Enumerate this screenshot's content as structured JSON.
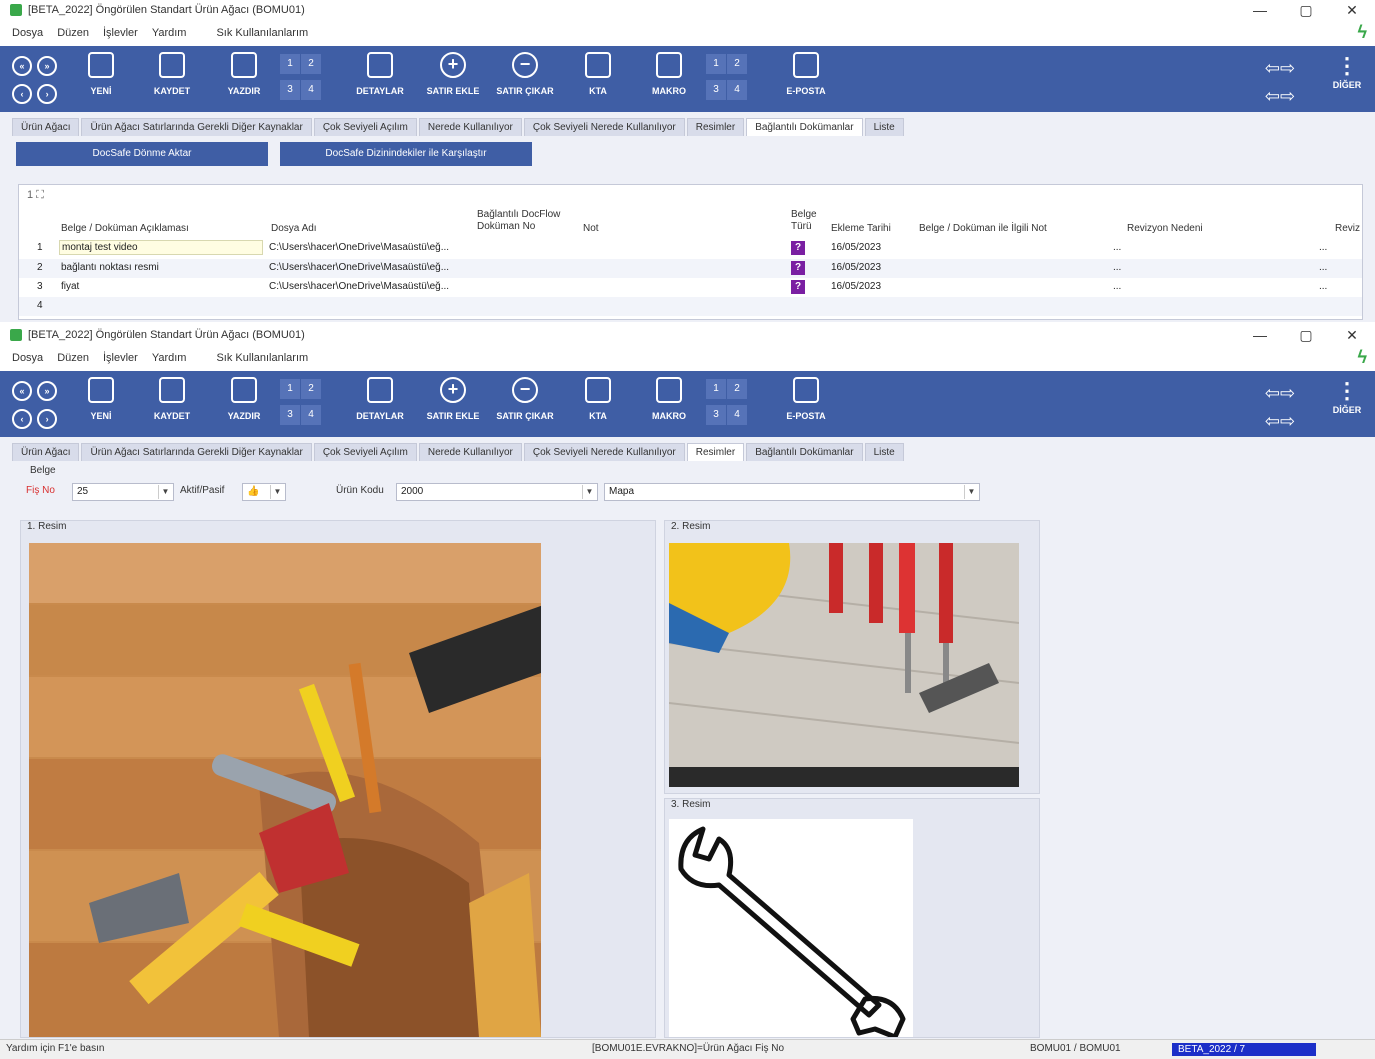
{
  "window": {
    "title": "[BETA_2022] Öngörülen Standart Ürün Ağacı (BOMU01)",
    "controls": [
      "—",
      "▢",
      "✕"
    ]
  },
  "menu": [
    "Dosya",
    "Düzen",
    "İşlevler",
    "Yardım",
    "Sık Kullanılanlarım"
  ],
  "toolbar": {
    "nav_top": [
      "«",
      "»"
    ],
    "nav_bottom": [
      "‹",
      "›"
    ],
    "buttons": {
      "new": "YENİ",
      "save": "KAYDET",
      "print": "YAZDIR",
      "details": "DETAYLAR",
      "add_row": "SATIR EKLE",
      "remove_row": "SATIR ÇIKAR",
      "kta": "KTA",
      "macro": "MAKRO",
      "email": "E-POSTA",
      "more": "DİĞER"
    },
    "num_grid": [
      "1",
      "2",
      "3",
      "4"
    ]
  },
  "tabs1": [
    "Ürün Ağacı",
    "Ürün Ağacı Satırlarında Gerekli Diğer Kaynaklar",
    "Çok Seviyeli Açılım",
    "Nerede Kullanılıyor",
    "Çok Seviyeli Nerede Kullanılıyor",
    "Resimler",
    "Bağlantılı Dokümanlar",
    "Liste"
  ],
  "tabs2": [
    "Ürün Ağacı",
    "Ürün Ağacı Satırlarında Gerekli Diğer Kaynaklar",
    "Çok Seviyeli Açılım",
    "Nerede Kullanılıyor",
    "Çok Seviyeli Nerede Kullanılıyor",
    "Resimler",
    "Bağlantılı Dokümanlar",
    "Liste"
  ],
  "docs": {
    "transfer_button": "DocSafe Dönme Aktar",
    "compare_button": "DocSafe Dizinindekiler ile Karşılaştır",
    "corner": "1 ⛶",
    "headers": {
      "desc": "Belge / Doküman Açıklaması",
      "file": "Dosya Adı",
      "docflow": "Bağlantılı DocFlow Doküman No",
      "note": "Not",
      "type": "Belge Türü",
      "date": "Ekleme Tarihi",
      "related_note": "Belge / Doküman ile İlgili Not",
      "rev_reason": "Revizyon Nedeni",
      "rev": "Reviz"
    },
    "rows": [
      {
        "no": "1",
        "desc": "montaj test video",
        "file": "C:\\Users\\hacer\\OneDrive\\Masaüstü\\eğ...",
        "badge": "?",
        "date": "16/05/2023",
        "dash1": "...",
        "dash2": "..."
      },
      {
        "no": "2",
        "desc": "bağlantı noktası resmi",
        "file": "C:\\Users\\hacer\\OneDrive\\Masaüstü\\eğ...",
        "badge": "?",
        "date": "16/05/2023",
        "dash1": "...",
        "dash2": "..."
      },
      {
        "no": "3",
        "desc": "fiyat",
        "file": "C:\\Users\\hacer\\OneDrive\\Masaüstü\\eğ...",
        "badge": "?",
        "date": "16/05/2023",
        "dash1": "...",
        "dash2": "..."
      },
      {
        "no": "4",
        "desc": "",
        "file": "",
        "badge": "",
        "date": "",
        "dash1": "",
        "dash2": ""
      }
    ]
  },
  "images_tab": {
    "group": "Belge",
    "fis_label": "Fiş No",
    "fis_value": "25",
    "active_label": "Aktif/Pasif",
    "active_value": "👍",
    "product_label": "Ürün Kodu",
    "product_value": "2000",
    "product_name": "Mapa",
    "image1": "1. Resim",
    "image2": "2. Resim",
    "image3": "3. Resim"
  },
  "status": {
    "help": "Yardım için F1'e basın",
    "field": "[BOMU01E.EVRAKNO]=Ürün Ağacı Fiş No",
    "module": "BOMU01 / BOMU01",
    "db": "BETA_2022 / 7"
  }
}
